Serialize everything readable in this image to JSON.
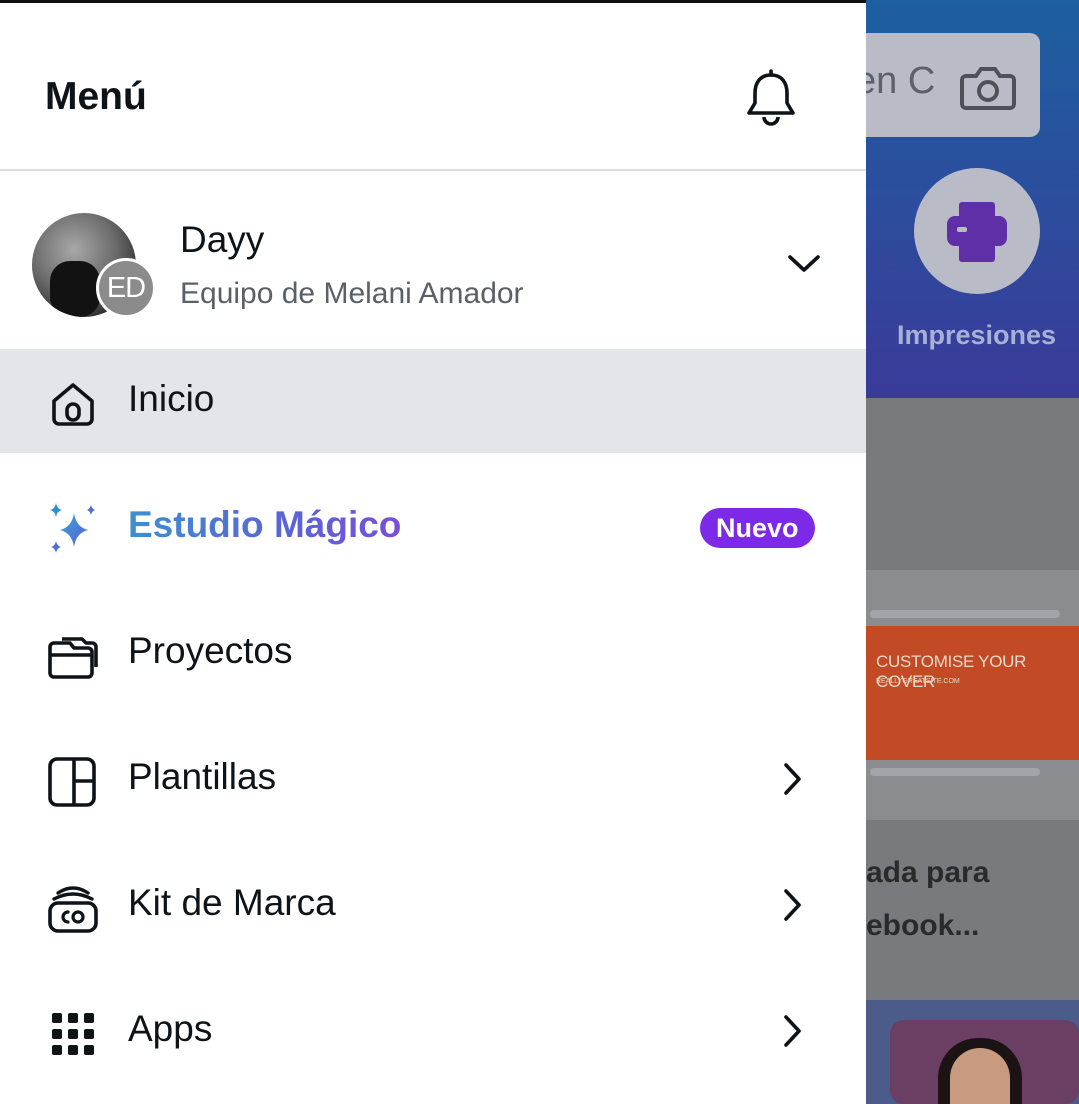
{
  "background": {
    "search_text": "en C",
    "print_label": "Impresiones",
    "card_title": "CUSTOMISE YOUR COVER",
    "card_subtitle": "REALLYGREATSITE.COM",
    "caption_line1": "ada para",
    "caption_line2": "ebook..."
  },
  "drawer": {
    "title": "Menú",
    "notifications_icon": "bell-icon",
    "profile": {
      "name": "Dayy",
      "team": "Equipo de Melani Amador",
      "badge_initials": "ED"
    },
    "items": [
      {
        "label": "Inicio",
        "icon": "home-icon",
        "active": true
      },
      {
        "label": "Estudio Mágico",
        "icon": "sparkles-icon",
        "badge": "Nuevo"
      },
      {
        "label": "Proyectos",
        "icon": "folder-icon"
      },
      {
        "label": "Plantillas",
        "icon": "templates-icon",
        "has_submenu": true
      },
      {
        "label": "Kit de Marca",
        "icon": "brand-kit-icon",
        "has_submenu": true
      },
      {
        "label": "Apps",
        "icon": "apps-grid-icon",
        "has_submenu": true
      }
    ]
  },
  "colors": {
    "active_bg": "#e2e5e9",
    "badge_purple": "#7d2ae8",
    "magic_gradient_start": "#3d8fd0",
    "magic_gradient_end": "#7a4ed9"
  }
}
